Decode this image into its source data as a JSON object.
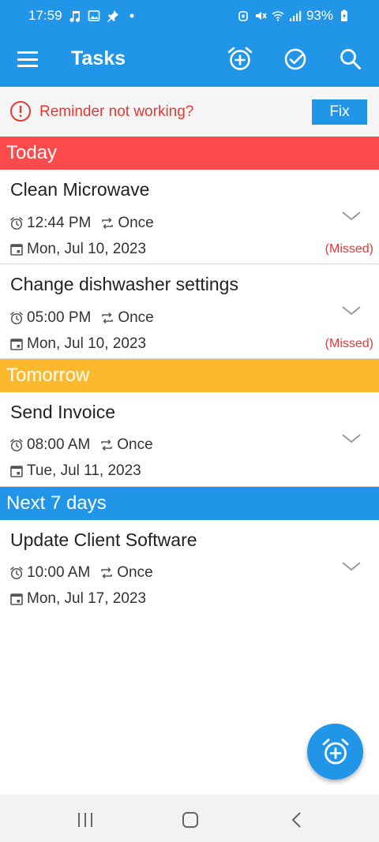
{
  "status_bar": {
    "time": "17:59",
    "battery": "93%"
  },
  "app_bar": {
    "title": "Tasks"
  },
  "banner": {
    "message": "Reminder not working?",
    "fix_label": "Fix"
  },
  "sections": [
    {
      "label": "Today",
      "color": "#fe4a4a"
    },
    {
      "label": "Tomorrow",
      "color": "#fdb92c"
    },
    {
      "label": "Next 7 days",
      "color": "#2196e8"
    }
  ],
  "tasks": [
    {
      "title": "Clean Microwave",
      "time": "12:44 PM",
      "repeat": "Once",
      "date": "Mon, Jul 10, 2023",
      "status": "(Missed)"
    },
    {
      "title": "Change dishwasher settings",
      "time": "05:00 PM",
      "repeat": "Once",
      "date": "Mon, Jul 10, 2023",
      "status": "(Missed)"
    },
    {
      "title": "Send Invoice",
      "time": "08:00 AM",
      "repeat": "Once",
      "date": "Tue, Jul 11, 2023",
      "status": ""
    },
    {
      "title": "Update Client Software",
      "time": "10:00 AM",
      "repeat": "Once",
      "date": "Mon, Jul 17, 2023",
      "status": ""
    }
  ],
  "colors": {
    "accent": "#2196e8",
    "missed": "#e53935"
  }
}
